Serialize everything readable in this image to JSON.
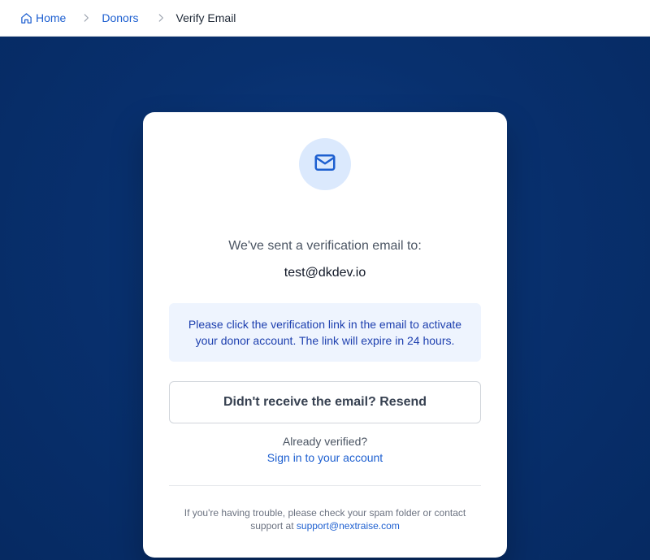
{
  "breadcrumb": {
    "home_label": "Home",
    "donors_label": "Donors",
    "current_label": "Verify Email"
  },
  "card": {
    "sent_text": "We've sent a verification email to:",
    "email": "test@dkdev.io",
    "info_text": "Please click the verification link in the email to activate your donor account. The link will expire in 24 hours.",
    "resend_label": "Didn't receive the email? Resend",
    "already_verified": "Already verified?",
    "signin_label": "Sign in to your account",
    "trouble_text": "If you're having trouble, please check your spam folder or contact support at",
    "support_email": "support@nextraise.com"
  },
  "icons": {
    "home": "home-icon",
    "separator": "chevron-right-icon",
    "mail": "mail-icon"
  },
  "colors": {
    "accent": "#1d5fd0",
    "hero_bg": "#08306e",
    "info_bg": "#eef4fe",
    "icon_circle": "#dbe9fd"
  }
}
